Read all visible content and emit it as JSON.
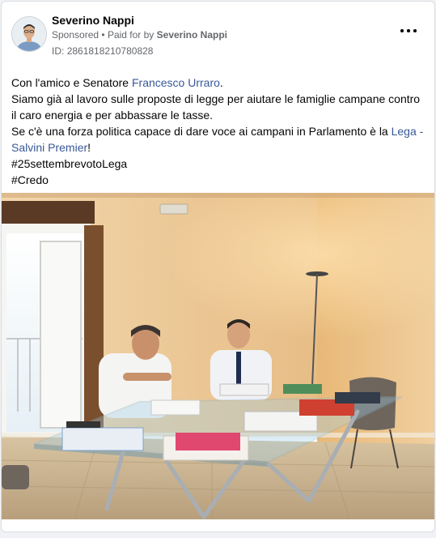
{
  "header": {
    "page_name": "Severino Nappi",
    "sponsored_label": "Sponsored",
    "separator": "•",
    "paid_for_prefix": "Paid for by",
    "paid_for_name": "Severino Nappi",
    "id_label": "ID:",
    "id_value": "2861818210780828",
    "more_icon": "more-horizontal-icon"
  },
  "post": {
    "line1_pre": "Con l'amico e Senatore ",
    "line1_link": "Francesco Urraro",
    "line1_post": ".",
    "line2": "Siamo già al lavoro sulle proposte di legge per aiutare le famiglie campane contro il caro energia e per abbassare le tasse.",
    "line3_pre": "Se c'è una forza politica capace di dare voce ai campani in Parlamento è la ",
    "line3_link": "Lega - Salvini Premier",
    "line3_post": "!",
    "hashtag1": "#25settembrevotoLega",
    "hashtag2": "#Credo"
  },
  "colors": {
    "link": "#385898",
    "secondary_text": "#65676b",
    "wall": "#e8c08a",
    "floor": "#c9b392"
  },
  "image": {
    "subject": "two men in suits at a glass desk in an office with papers"
  }
}
